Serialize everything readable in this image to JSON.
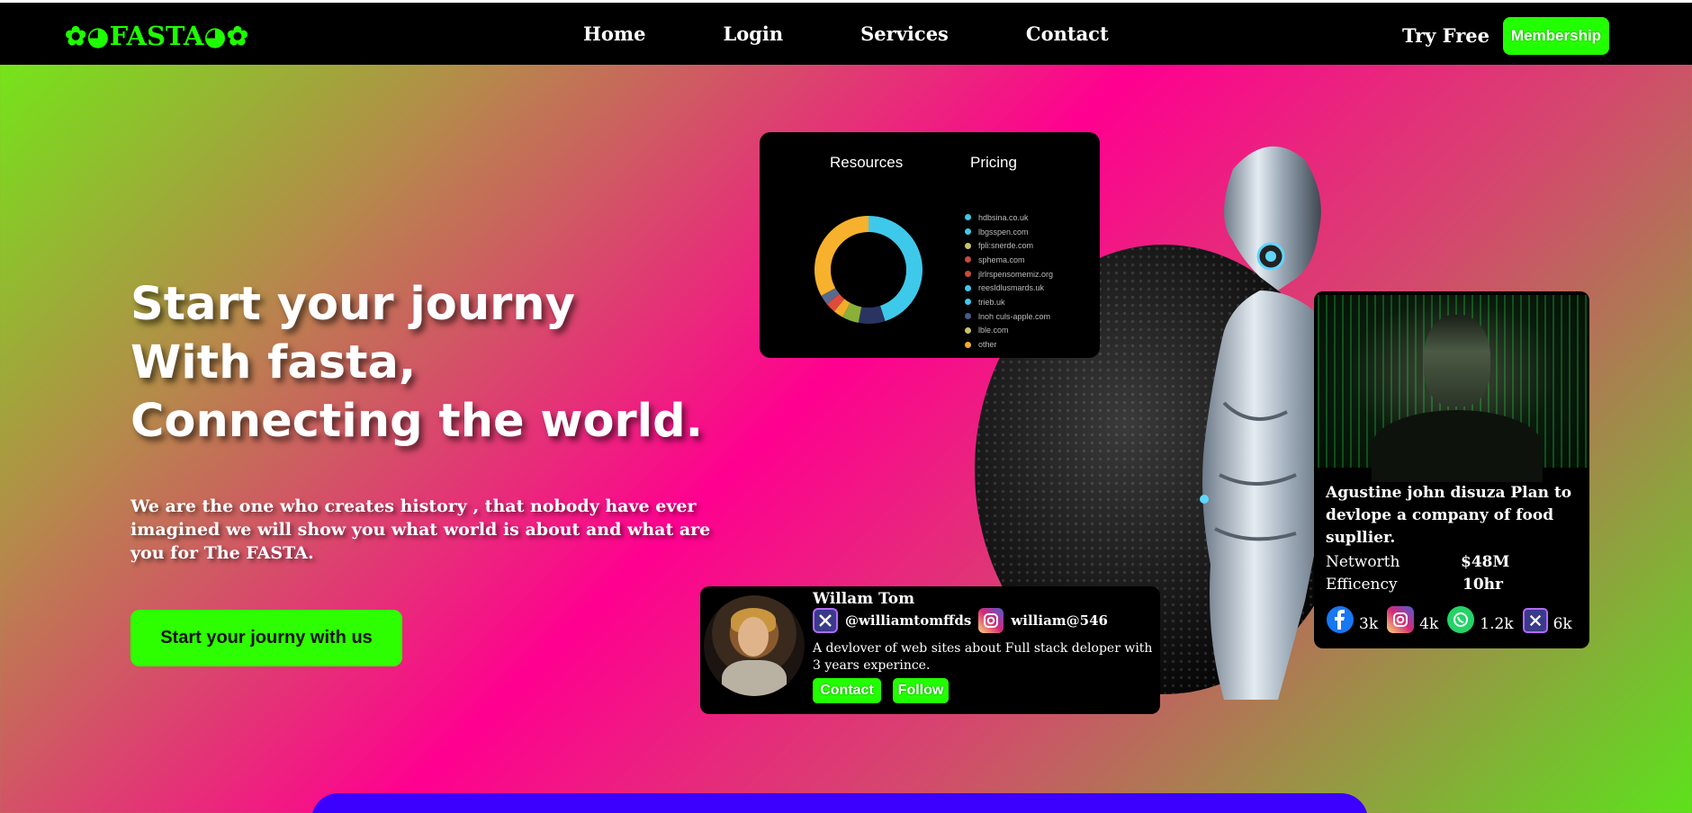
{
  "nav": {
    "logo": "✿◕FASTA◕✿",
    "links": [
      "Home",
      "Login",
      "Services",
      "Contact"
    ],
    "try_free": "Try Free",
    "membership": "Membership"
  },
  "hero": {
    "headline": [
      "Start your journy",
      "With fasta,",
      "Connecting the world."
    ],
    "subtext": "We are the one who creates history , that nobody have ever imagined we will show you what world is about and what are you for The FASTA.",
    "cta": "Start your journy with us"
  },
  "pie_card": {
    "tabs": [
      "Resources",
      "Pricing"
    ],
    "legend": [
      {
        "label": "hdbsina.co.uk",
        "color": "#3ec9ea"
      },
      {
        "label": "lbgsspen.com",
        "color": "#3ec9ea"
      },
      {
        "label": "fpli:snerde.com",
        "color": "#c9c36a"
      },
      {
        "label": "sphema.com",
        "color": "#c94a3b"
      },
      {
        "label": "jlrlrspensomemiz.org",
        "color": "#c94a3b"
      },
      {
        "label": "reesldlusmards.uk",
        "color": "#3ec9ea"
      },
      {
        "label": "trieb.uk",
        "color": "#3ec9ea"
      },
      {
        "label": "lnoh culs-apple.com",
        "color": "#4a5a8a"
      },
      {
        "label": "lble.com",
        "color": "#c9c36a"
      },
      {
        "label": "other",
        "color": "#f2ac2a"
      }
    ],
    "slices": [
      {
        "value": 45,
        "color": "#3ec9ea"
      },
      {
        "value": 8,
        "color": "#2a3460"
      },
      {
        "value": 5,
        "color": "#8ab03a"
      },
      {
        "value": 3,
        "color": "#f2ac2a"
      },
      {
        "value": 3,
        "color": "#e04a3a"
      },
      {
        "value": 3,
        "color": "#5a6a8a"
      },
      {
        "value": 33,
        "color": "#f7b12c"
      }
    ]
  },
  "profile": {
    "name": "Willam Tom",
    "twitter": "@williamtomffds",
    "instagram": "william@546",
    "description": "A devlover of web sites about Full stack deloper with 3 years experince.",
    "contact_label": "Contact",
    "follow_label": "Follow"
  },
  "agent": {
    "title": "Agustine john disuza Plan to devlope a company of food supllier.",
    "networth_label": "Networth",
    "networth_value": "$48M",
    "efficency_label": "Efficency",
    "efficency_value": "10hr",
    "stats": {
      "facebook": "3k",
      "instagram": "4k",
      "whatsapp": "1.2k",
      "twitter": "6k"
    }
  }
}
